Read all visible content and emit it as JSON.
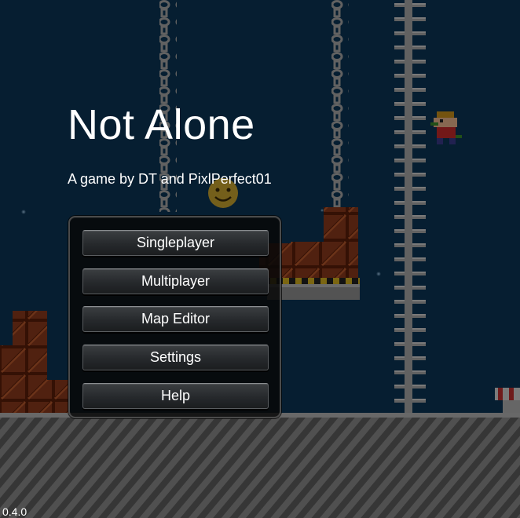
{
  "game": {
    "title": "Not Alone",
    "subtitle": "A game by DT and PixlPerfect01",
    "version": "0.4.0"
  },
  "menu": {
    "buttons": [
      {
        "label": "Singleplayer"
      },
      {
        "label": "Multiplayer"
      },
      {
        "label": "Map Editor"
      },
      {
        "label": "Settings"
      },
      {
        "label": "Help"
      }
    ]
  },
  "colors": {
    "sky": "#0e3a5c",
    "overlay": "#000000",
    "crate": "#8a3a1c",
    "chain": "#9a9a9a",
    "floor": "#7c7c7c",
    "text": "#ffffff"
  }
}
